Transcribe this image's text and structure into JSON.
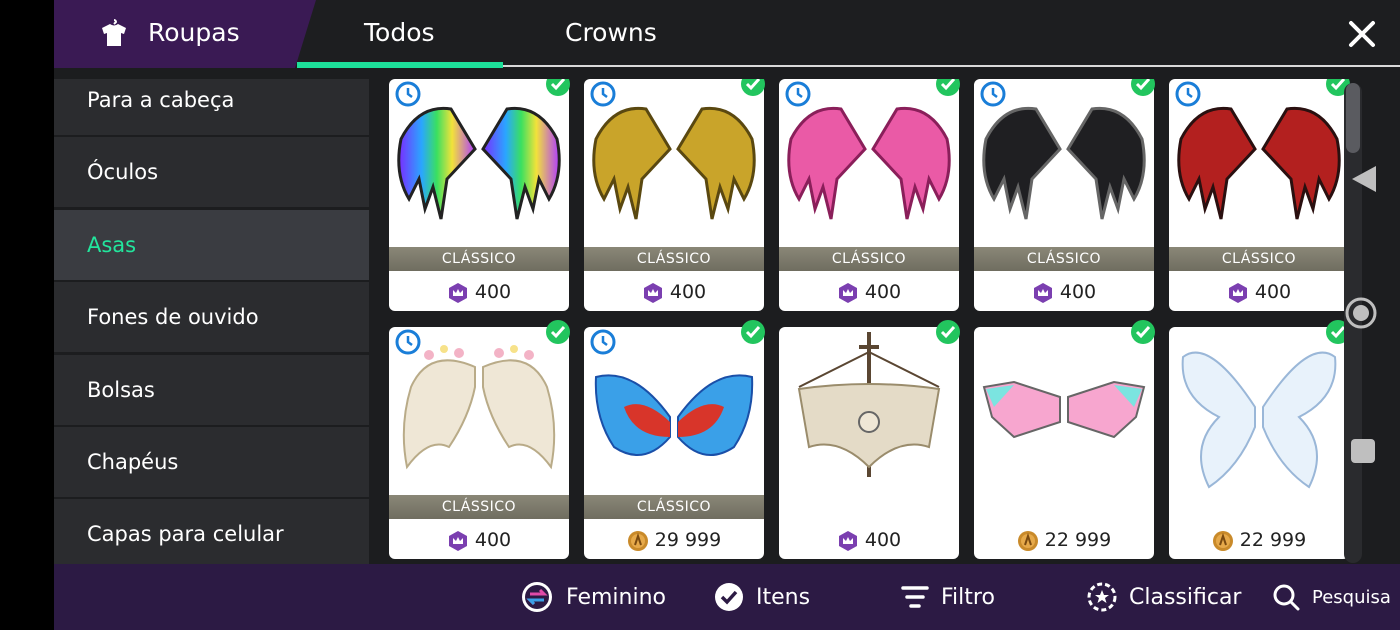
{
  "header": {
    "title": "Roupas",
    "title_icon": "shirt-icon",
    "tabs": [
      {
        "label": "Todos",
        "active": true
      },
      {
        "label": "Crowns",
        "active": false
      }
    ],
    "close_icon": "close-icon",
    "accent_color": "#1de09a",
    "title_bg_color": "#3a1a54"
  },
  "sidebar": {
    "items": [
      {
        "label": "Para a cabeça",
        "active": false
      },
      {
        "label": "Óculos",
        "active": false
      },
      {
        "label": "Asas",
        "active": true
      },
      {
        "label": "Fones de ouvido",
        "active": false
      },
      {
        "label": "Bolsas",
        "active": false
      },
      {
        "label": "Chapéus",
        "active": false
      },
      {
        "label": "Capas para celular",
        "active": false
      }
    ]
  },
  "items": [
    {
      "item": "rainbow-dragon-wings-icon",
      "band": "CLÁSSICO",
      "price": "400",
      "currency": "crown-icon",
      "timed": true,
      "owned": true
    },
    {
      "item": "gold-dragon-wings-icon",
      "band": "CLÁSSICO",
      "price": "400",
      "currency": "crown-icon",
      "timed": true,
      "owned": true
    },
    {
      "item": "pink-dragon-wings-icon",
      "band": "CLÁSSICO",
      "price": "400",
      "currency": "crown-icon",
      "timed": true,
      "owned": true
    },
    {
      "item": "black-dragon-wings-icon",
      "band": "CLÁSSICO",
      "price": "400",
      "currency": "crown-icon",
      "timed": true,
      "owned": true
    },
    {
      "item": "red-dragon-wings-icon",
      "band": "CLÁSSICO",
      "price": "400",
      "currency": "crown-icon",
      "timed": true,
      "owned": true
    },
    {
      "item": "floral-angel-wings-icon",
      "band": "CLÁSSICO",
      "price": "400",
      "currency": "crown-icon",
      "timed": true,
      "owned": true
    },
    {
      "item": "rainbow-feather-wings-icon",
      "band": "CLÁSSICO",
      "price": "29 999",
      "currency": "coin-icon",
      "timed": true,
      "owned": true
    },
    {
      "item": "pirate-sail-wings-icon",
      "band": "",
      "price": "400",
      "currency": "crown-icon",
      "timed": false,
      "owned": true
    },
    {
      "item": "pastel-mech-wings-icon",
      "band": "",
      "price": "22 999",
      "currency": "coin-icon",
      "timed": false,
      "owned": true
    },
    {
      "item": "iridescent-fairy-wings-icon",
      "band": "",
      "price": "22 999",
      "currency": "coin-icon",
      "timed": false,
      "owned": true
    }
  ],
  "bottombar": {
    "feminino": "Feminino",
    "itens": "Itens",
    "filtro": "Filtro",
    "classificar": "Classificar",
    "pesquisa": "Pesquisa"
  }
}
